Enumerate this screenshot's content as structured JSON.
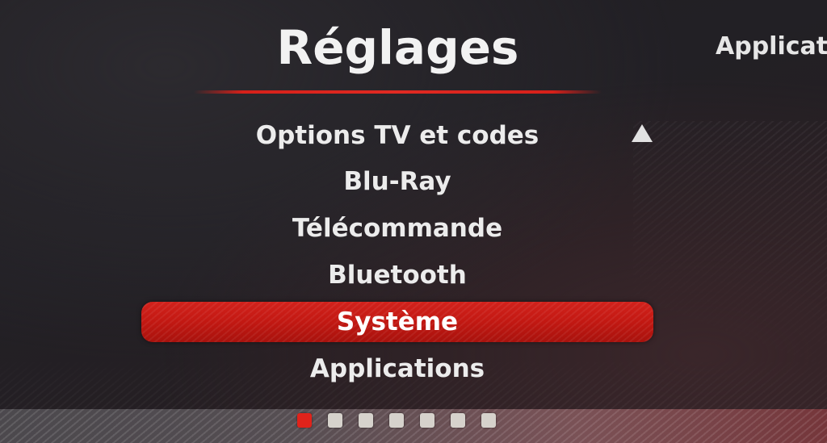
{
  "header": {
    "title": "Réglages",
    "next_title": "Applicat"
  },
  "menu": {
    "items": [
      {
        "label": "Options TV et codes"
      },
      {
        "label": "Blu-Ray"
      },
      {
        "label": "Télécommande"
      },
      {
        "label": "Bluetooth"
      },
      {
        "label": "Système",
        "selected": true
      },
      {
        "label": "Applications"
      }
    ]
  },
  "icons": {
    "scroll_up": "triangle-up-icon"
  },
  "pager": {
    "count": 7,
    "active_index": 0
  },
  "colors": {
    "accent": "#d6201a",
    "text": "#ececec",
    "pager_dot": "#d6d2cc"
  }
}
